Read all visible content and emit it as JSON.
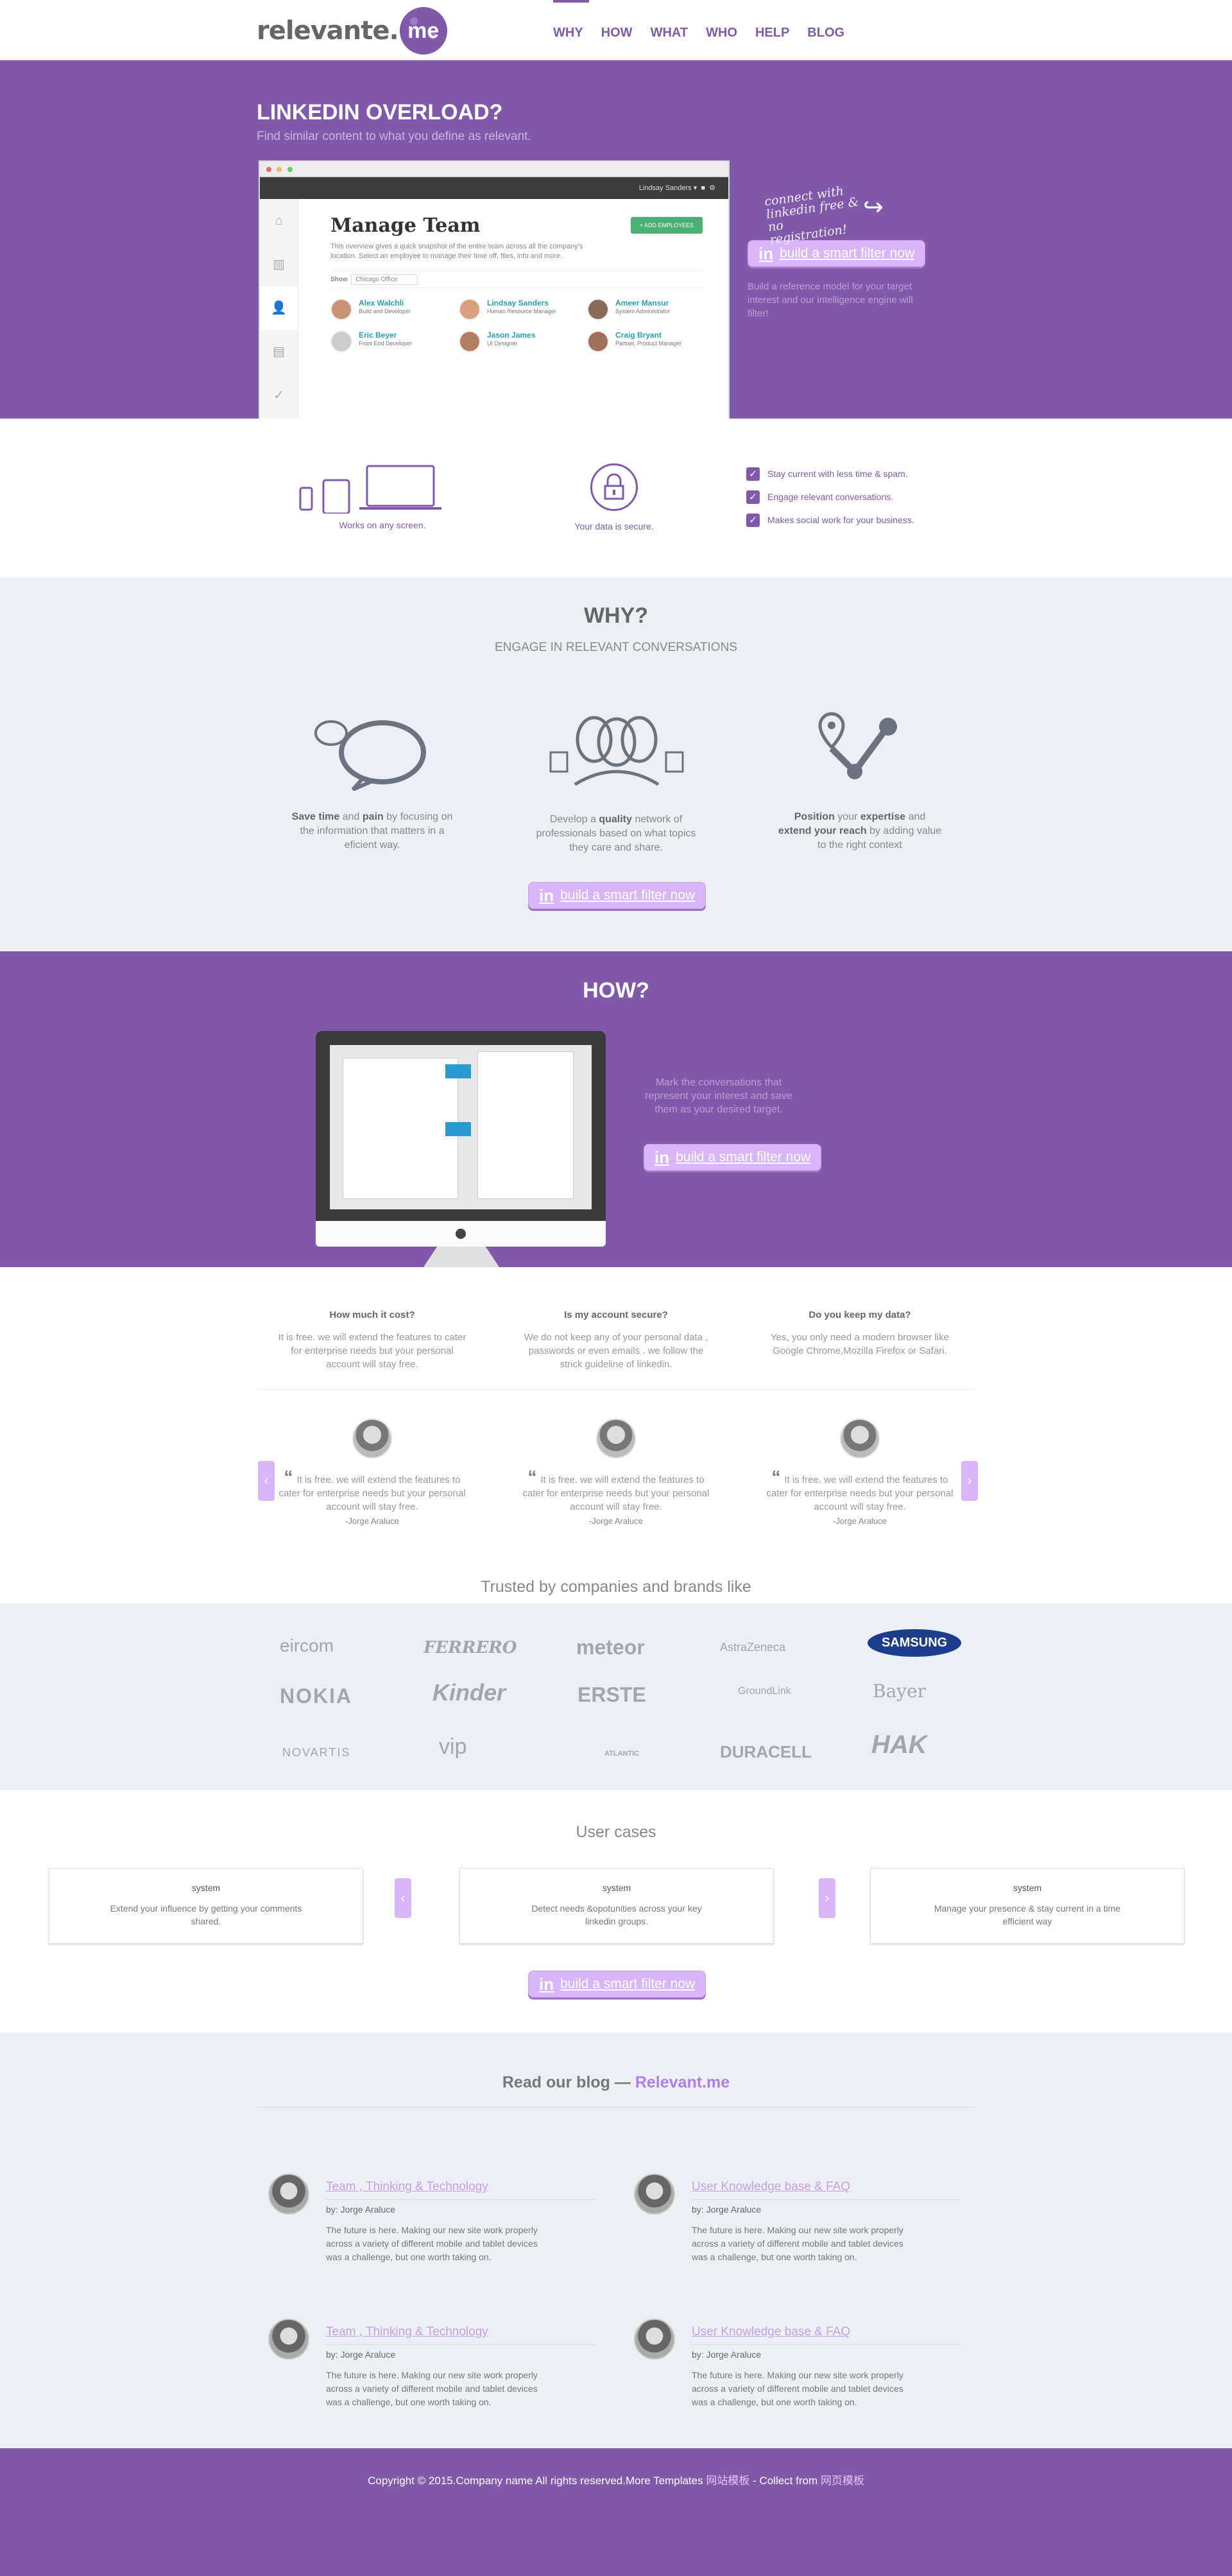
{
  "nav": {
    "logo_text": "relevante.",
    "logo_badge": "me",
    "items": [
      "WHY",
      "HOW",
      "WHAT",
      "WHO",
      "HELP",
      "BLOG"
    ]
  },
  "hero": {
    "title": "LINKEDIN OVERLOAD?",
    "subtitle": "Find similar content to what you define as relevant.",
    "screen": {
      "user": "Lindsay Sanders",
      "heading": "Manage Team",
      "description": "This overview gives a quick snapshot of the entire team across all the company's location. Select an employee to manage their time off, files, info and more.",
      "add_button": "+ ADD EMPLOYEES",
      "show_label": "Show",
      "show_value": "Chicago Office",
      "people": [
        {
          "name": "Alex Walchli",
          "role": "Build and Developer"
        },
        {
          "name": "Lindsay Sanders",
          "role": "Human Resource Manager"
        },
        {
          "name": "Ameer Mansur",
          "role": "System Administrator"
        },
        {
          "name": "Eric Beyer",
          "role": "Front End Developer"
        },
        {
          "name": "Jason James",
          "role": "UI Designer"
        },
        {
          "name": "Craig Bryant",
          "role": "Partner, Product Manager"
        }
      ]
    },
    "handwritten": "connect with linkedin free & no registration!",
    "button_icon": "in",
    "button": "build a smart filter now",
    "note": "Build a reference model for your target interest and our intelligence engine will filter!"
  },
  "features": {
    "screen_caption": "Works on any screen.",
    "secure_caption": "Your data is secure.",
    "checks": [
      "Stay current with less time & spam.",
      "Engage relevant conversations.",
      "Makes social work for your business."
    ]
  },
  "why": {
    "title": "WHY?",
    "subtitle": "ENGAGE IN RELEVANT CONVERSATIONS",
    "cols": [
      {
        "b1": "Save time",
        "t1": " and ",
        "b2": "pain",
        "t2": " by focusing on the information that matters in a eficient way."
      },
      {
        "t0": "Develop a ",
        "b1": "quality",
        "t1": " network of professionals based on what topics they care and share."
      },
      {
        "b1": "Position",
        "t1": " your ",
        "b2": "expertise",
        "t2": " and ",
        "b3": "extend your reach",
        "t3": " by adding value to the right context"
      }
    ],
    "button_icon": "in",
    "button": "build a smart filter now"
  },
  "how": {
    "title": "HOW?",
    "text": "Mark the conversations that represent your interest and save them as your desired target.",
    "button_icon": "in",
    "button": "build a smart filter now"
  },
  "faq": {
    "items": [
      {
        "q": "How much it cost?",
        "a": "It is free. we will extend the features to cater for enterprise needs but your personal account will stay free."
      },
      {
        "q": "Is my account secure?",
        "a": "We do not keep any of your personal data , passwords or even emails . we follow the strick guideline of linkedin."
      },
      {
        "q": "Do you keep my data?",
        "a": "Yes, you only need a modern browser like Google Chrome,Mozilla Firefox or Safari."
      }
    ],
    "testimonials": [
      {
        "quote": "It is free. we will extend the features to cater for enterprise needs but your personal account will stay free.",
        "author": "-Jorge Araluce"
      },
      {
        "quote": "It is free. we will extend the features to cater for enterprise needs but your personal account will stay free.",
        "author": "-Jorge Araluce"
      },
      {
        "quote": "It is free. we will extend the features to cater for enterprise needs but your personal account will stay free.",
        "author": "-Jorge Araluce"
      }
    ],
    "prev": "‹",
    "next": "›",
    "trusted": "Trusted by companies and brands like"
  },
  "logos": [
    "eircom",
    "FERRERO",
    "meteor",
    "AstraZeneca",
    "SAMSUNG",
    "NOKIA",
    "Kinder",
    "ERSTE",
    "GroundLink",
    "Bayer",
    "NOVARTIS",
    "vip",
    "ATLANTIC",
    "DURACELL",
    "HAK"
  ],
  "cases": {
    "title": "User cases",
    "items": [
      {
        "img": "system",
        "text": "Extend your influence by getting your comments shared."
      },
      {
        "img": "system",
        "text": "Detect needs &opotunities across your key linkedin groups."
      },
      {
        "img": "system",
        "text": "Manage your presence & stay current in a time efficient way"
      }
    ],
    "prev": "‹",
    "next": "›",
    "button_icon": "in",
    "button": "build a smart filter now"
  },
  "blog": {
    "title_prefix": "Read our blog — ",
    "title_link": "Relevant.me",
    "posts": [
      {
        "title": "Team , Thinking & Technology",
        "by": "by: Jorge Araluce",
        "text": "The future is here. Making our new site work properly across a variety of different mobile and tablet devices was a challenge, but one worth taking on."
      },
      {
        "title": "User Knowledge base & FAQ",
        "by": "by: Jorge Araluce",
        "text": "The future is here. Making our new site work properly across a variety of different mobile and tablet devices was a challenge, but one worth taking on."
      },
      {
        "title": "Team , Thinking & Technology",
        "by": "by: Jorge Araluce",
        "text": "The future is here. Making our new site work properly across a variety of different mobile and tablet devices was a challenge, but one worth taking on."
      },
      {
        "title": "User Knowledge base & FAQ",
        "by": "by: Jorge Araluce",
        "text": "The future is here. Making our new site work properly across a variety of different mobile and tablet devices was a challenge, but one worth taking on."
      }
    ]
  },
  "footer": {
    "text": "Copyright © 2015.Company name All rights reserved.More Templates ",
    "link1": "网站模板",
    "middle": " - Collect from ",
    "link2": "网页模板"
  },
  "colors": {
    "brand": "#8159aa",
    "button": "#d9b6f7",
    "light_bg": "#ecf0f4"
  }
}
